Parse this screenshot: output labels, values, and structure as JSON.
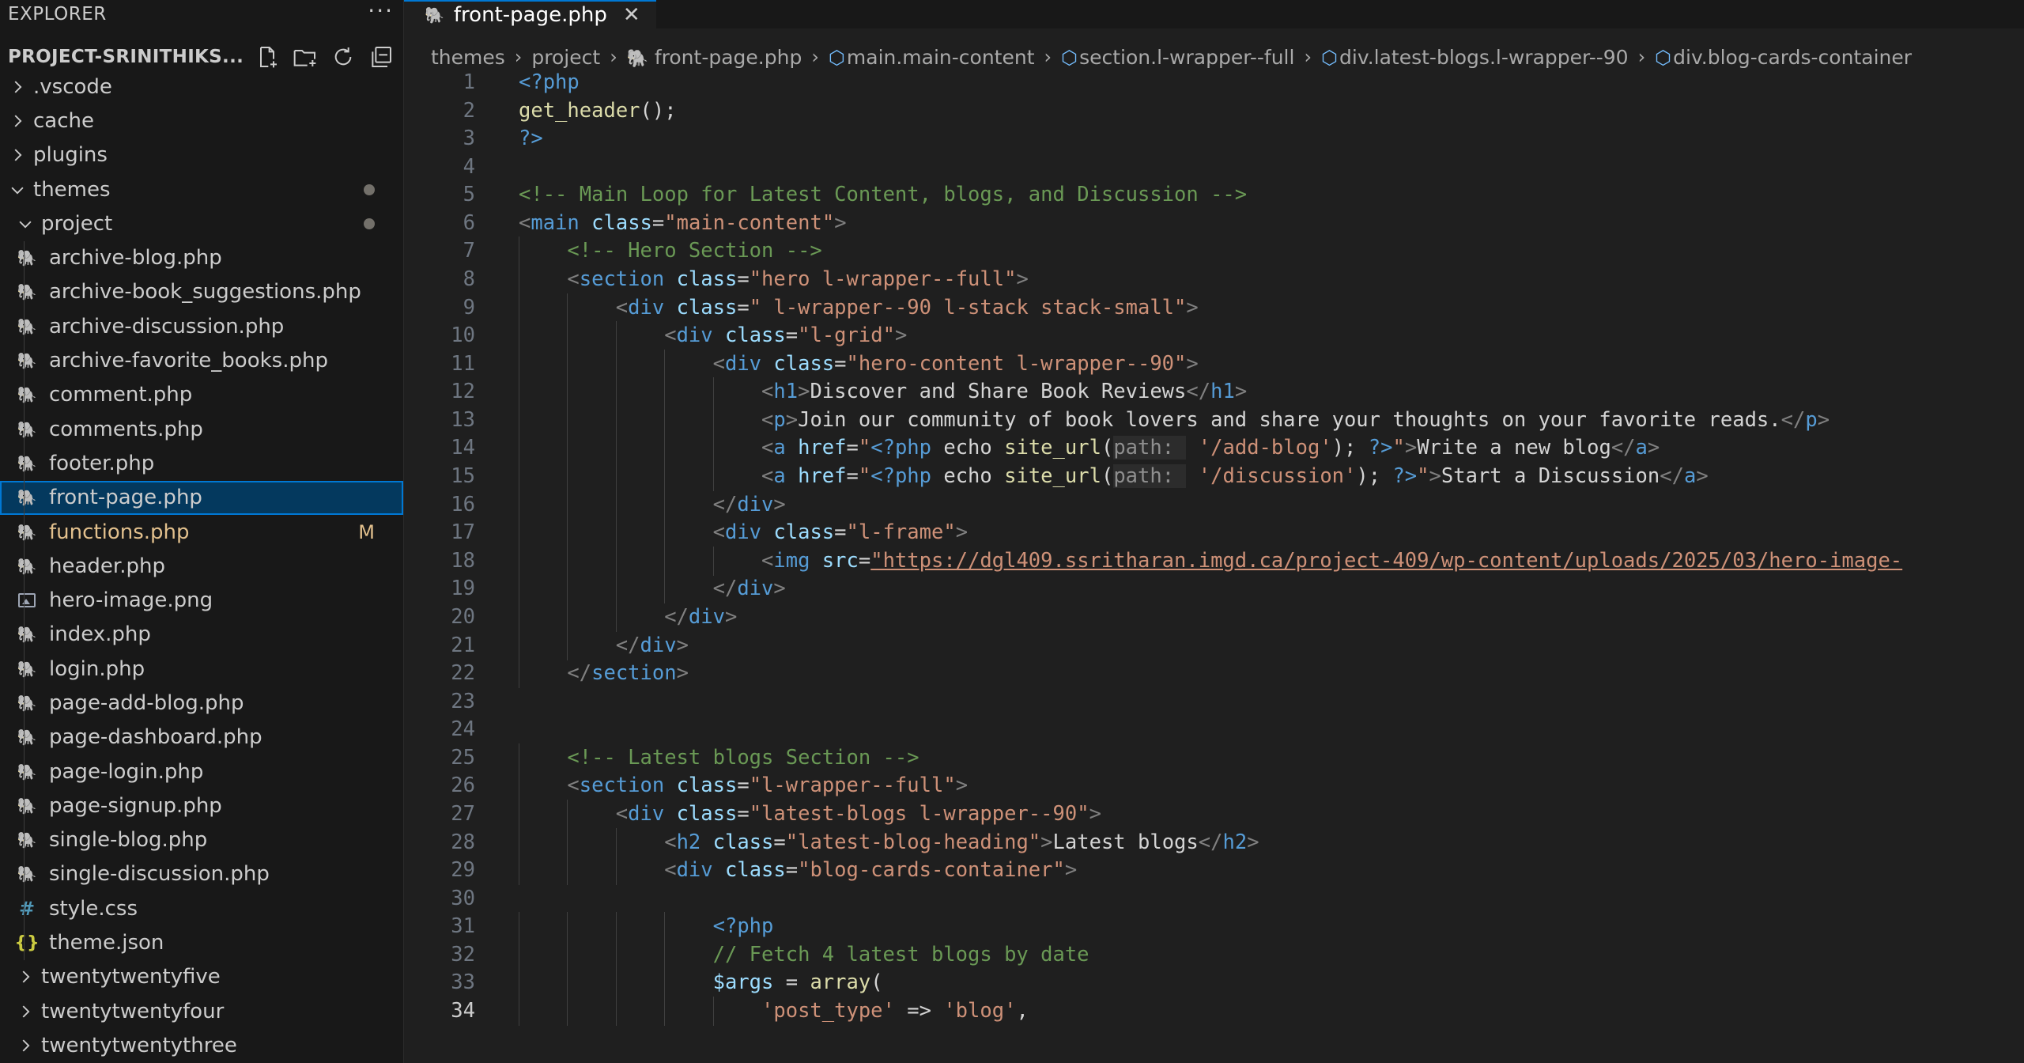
{
  "explorer": {
    "title": "EXPLORER",
    "more": "···",
    "project_name": "PROJECT-SRINITHIKS...",
    "tree": [
      {
        "label": ".vscode",
        "kind": "folder",
        "open": false,
        "depth": 0
      },
      {
        "label": "cache",
        "kind": "folder",
        "open": false,
        "depth": 0
      },
      {
        "label": "plugins",
        "kind": "folder",
        "open": false,
        "depth": 0
      },
      {
        "label": "themes",
        "kind": "folder",
        "open": true,
        "depth": 0,
        "dot": true
      },
      {
        "label": "project",
        "kind": "folder",
        "open": true,
        "depth": 1,
        "dot": true
      },
      {
        "label": "archive-blog.php",
        "kind": "php",
        "depth": 2
      },
      {
        "label": "archive-book_suggestions.php",
        "kind": "php",
        "depth": 2
      },
      {
        "label": "archive-discussion.php",
        "kind": "php",
        "depth": 2
      },
      {
        "label": "archive-favorite_books.php",
        "kind": "php",
        "depth": 2
      },
      {
        "label": "comment.php",
        "kind": "php",
        "depth": 2
      },
      {
        "label": "comments.php",
        "kind": "php",
        "depth": 2
      },
      {
        "label": "footer.php",
        "kind": "php",
        "depth": 2
      },
      {
        "label": "front-page.php",
        "kind": "php",
        "depth": 2,
        "selected": true
      },
      {
        "label": "functions.php",
        "kind": "php",
        "depth": 2,
        "badge": "M"
      },
      {
        "label": "header.php",
        "kind": "php",
        "depth": 2
      },
      {
        "label": "hero-image.png",
        "kind": "image",
        "depth": 2
      },
      {
        "label": "index.php",
        "kind": "php",
        "depth": 2
      },
      {
        "label": "login.php",
        "kind": "php",
        "depth": 2
      },
      {
        "label": "page-add-blog.php",
        "kind": "php",
        "depth": 2
      },
      {
        "label": "page-dashboard.php",
        "kind": "php",
        "depth": 2
      },
      {
        "label": "page-login.php",
        "kind": "php",
        "depth": 2
      },
      {
        "label": "page-signup.php",
        "kind": "php",
        "depth": 2
      },
      {
        "label": "single-blog.php",
        "kind": "php",
        "depth": 2
      },
      {
        "label": "single-discussion.php",
        "kind": "php",
        "depth": 2
      },
      {
        "label": "style.css",
        "kind": "css",
        "depth": 2
      },
      {
        "label": "theme.json",
        "kind": "json",
        "depth": 2
      },
      {
        "label": "twentytwentyfive",
        "kind": "folder",
        "open": false,
        "depth": 1
      },
      {
        "label": "twentytwentyfour",
        "kind": "folder",
        "open": false,
        "depth": 1
      },
      {
        "label": "twentytwentythree",
        "kind": "folder",
        "open": false,
        "depth": 1
      }
    ]
  },
  "editor": {
    "tab_label": "front-page.php",
    "tab_close": "✕",
    "breadcrumb": [
      {
        "label": "themes",
        "icon": ""
      },
      {
        "label": "project",
        "icon": ""
      },
      {
        "label": "front-page.php",
        "icon": "php"
      },
      {
        "label": "main.main-content",
        "icon": "cube"
      },
      {
        "label": "section.l-wrapper--full",
        "icon": "cube"
      },
      {
        "label": "div.latest-blogs.l-wrapper--90",
        "icon": "cube"
      },
      {
        "label": "div.blog-cards-container",
        "icon": "cube"
      }
    ],
    "active_line": 34,
    "lines": [
      {
        "n": "1",
        "indent": 0,
        "tokens": [
          [
            "php",
            "<?php"
          ]
        ]
      },
      {
        "n": "2",
        "indent": 0,
        "tokens": [
          [
            "fn",
            "get_header"
          ],
          [
            "txt",
            "();"
          ]
        ]
      },
      {
        "n": "3",
        "indent": 0,
        "tokens": [
          [
            "php",
            "?>"
          ]
        ]
      },
      {
        "n": "4",
        "indent": 0,
        "tokens": []
      },
      {
        "n": "5",
        "indent": 0,
        "tokens": [
          [
            "com",
            "<!-- Main Loop for Latest Content, blogs, and Discussion -->"
          ]
        ]
      },
      {
        "n": "6",
        "indent": 0,
        "tokens": [
          [
            "br",
            "<"
          ],
          [
            "tag",
            "main"
          ],
          [
            "txt",
            " "
          ],
          [
            "attr",
            "class"
          ],
          [
            "txt",
            "="
          ],
          [
            "str",
            "\"main-content\""
          ],
          [
            "br",
            ">"
          ]
        ]
      },
      {
        "n": "7",
        "indent": 1,
        "tokens": [
          [
            "com",
            "<!-- Hero Section -->"
          ]
        ]
      },
      {
        "n": "8",
        "indent": 1,
        "tokens": [
          [
            "br",
            "<"
          ],
          [
            "tag",
            "section"
          ],
          [
            "txt",
            " "
          ],
          [
            "attr",
            "class"
          ],
          [
            "txt",
            "="
          ],
          [
            "str",
            "\"hero l-wrapper--full\""
          ],
          [
            "br",
            ">"
          ]
        ]
      },
      {
        "n": "9",
        "indent": 2,
        "tokens": [
          [
            "br",
            "<"
          ],
          [
            "tag",
            "div"
          ],
          [
            "txt",
            " "
          ],
          [
            "attr",
            "class"
          ],
          [
            "txt",
            "="
          ],
          [
            "str",
            "\" l-wrapper--90 l-stack stack-small\""
          ],
          [
            "br",
            ">"
          ]
        ]
      },
      {
        "n": "10",
        "indent": 3,
        "tokens": [
          [
            "br",
            "<"
          ],
          [
            "tag",
            "div"
          ],
          [
            "txt",
            " "
          ],
          [
            "attr",
            "class"
          ],
          [
            "txt",
            "="
          ],
          [
            "str",
            "\"l-grid\""
          ],
          [
            "br",
            ">"
          ]
        ]
      },
      {
        "n": "11",
        "indent": 4,
        "tokens": [
          [
            "br",
            "<"
          ],
          [
            "tag",
            "div"
          ],
          [
            "txt",
            " "
          ],
          [
            "attr",
            "class"
          ],
          [
            "txt",
            "="
          ],
          [
            "str",
            "\"hero-content l-wrapper--90\""
          ],
          [
            "br",
            ">"
          ]
        ]
      },
      {
        "n": "12",
        "indent": 5,
        "tokens": [
          [
            "br",
            "<"
          ],
          [
            "tag",
            "h1"
          ],
          [
            "br",
            ">"
          ],
          [
            "txt",
            "Discover and Share Book Reviews"
          ],
          [
            "br",
            "</"
          ],
          [
            "tag",
            "h1"
          ],
          [
            "br",
            ">"
          ]
        ]
      },
      {
        "n": "13",
        "indent": 5,
        "tokens": [
          [
            "br",
            "<"
          ],
          [
            "tag",
            "p"
          ],
          [
            "br",
            ">"
          ],
          [
            "txt",
            "Join our community of book lovers and share your thoughts on your favorite reads."
          ],
          [
            "br",
            "</"
          ],
          [
            "tag",
            "p"
          ],
          [
            "br",
            ">"
          ]
        ]
      },
      {
        "n": "14",
        "indent": 5,
        "tokens": [
          [
            "br",
            "<"
          ],
          [
            "tag",
            "a"
          ],
          [
            "txt",
            " "
          ],
          [
            "attr",
            "href"
          ],
          [
            "txt",
            "="
          ],
          [
            "str",
            "\""
          ],
          [
            "php",
            "<?php"
          ],
          [
            "txt",
            " echo "
          ],
          [
            "fn",
            "site_url"
          ],
          [
            "txt",
            "("
          ],
          [
            "hint",
            "path: "
          ],
          [
            "txt",
            " "
          ],
          [
            "str",
            "'/add-blog'"
          ],
          [
            "txt",
            "); "
          ],
          [
            "php",
            "?>"
          ],
          [
            "str",
            "\""
          ],
          [
            "br",
            ">"
          ],
          [
            "txt",
            "Write a new blog"
          ],
          [
            "br",
            "</"
          ],
          [
            "tag",
            "a"
          ],
          [
            "br",
            ">"
          ]
        ]
      },
      {
        "n": "15",
        "indent": 5,
        "tokens": [
          [
            "br",
            "<"
          ],
          [
            "tag",
            "a"
          ],
          [
            "txt",
            " "
          ],
          [
            "attr",
            "href"
          ],
          [
            "txt",
            "="
          ],
          [
            "str",
            "\""
          ],
          [
            "php",
            "<?php"
          ],
          [
            "txt",
            " echo "
          ],
          [
            "fn",
            "site_url"
          ],
          [
            "txt",
            "("
          ],
          [
            "hint",
            "path: "
          ],
          [
            "txt",
            " "
          ],
          [
            "str",
            "'/discussion'"
          ],
          [
            "txt",
            "); "
          ],
          [
            "php",
            "?>"
          ],
          [
            "str",
            "\""
          ],
          [
            "br",
            ">"
          ],
          [
            "txt",
            "Start a Discussion"
          ],
          [
            "br",
            "</"
          ],
          [
            "tag",
            "a"
          ],
          [
            "br",
            ">"
          ]
        ]
      },
      {
        "n": "16",
        "indent": 4,
        "tokens": [
          [
            "br",
            "</"
          ],
          [
            "tag",
            "div"
          ],
          [
            "br",
            ">"
          ]
        ]
      },
      {
        "n": "17",
        "indent": 4,
        "tokens": [
          [
            "br",
            "<"
          ],
          [
            "tag",
            "div"
          ],
          [
            "txt",
            " "
          ],
          [
            "attr",
            "class"
          ],
          [
            "txt",
            "="
          ],
          [
            "str",
            "\"l-frame\""
          ],
          [
            "br",
            ">"
          ]
        ]
      },
      {
        "n": "18",
        "indent": 5,
        "tokens": [
          [
            "br",
            "<"
          ],
          [
            "tag",
            "img"
          ],
          [
            "txt",
            " "
          ],
          [
            "attr",
            "src"
          ],
          [
            "txt",
            "="
          ],
          [
            "url",
            "\"https://dgl409.ssritharan.imgd.ca/project-409/wp-content/uploads/2025/03/hero-image-"
          ]
        ]
      },
      {
        "n": "19",
        "indent": 4,
        "tokens": [
          [
            "br",
            "</"
          ],
          [
            "tag",
            "div"
          ],
          [
            "br",
            ">"
          ]
        ]
      },
      {
        "n": "20",
        "indent": 3,
        "tokens": [
          [
            "br",
            "</"
          ],
          [
            "tag",
            "div"
          ],
          [
            "br",
            ">"
          ]
        ]
      },
      {
        "n": "21",
        "indent": 2,
        "tokens": [
          [
            "br",
            "</"
          ],
          [
            "tag",
            "div"
          ],
          [
            "br",
            ">"
          ]
        ]
      },
      {
        "n": "22",
        "indent": 1,
        "tokens": [
          [
            "br",
            "</"
          ],
          [
            "tag",
            "section"
          ],
          [
            "br",
            ">"
          ]
        ]
      },
      {
        "n": "23",
        "indent": 0,
        "tokens": []
      },
      {
        "n": "24",
        "indent": 0,
        "tokens": []
      },
      {
        "n": "25",
        "indent": 1,
        "tokens": [
          [
            "com",
            "<!-- Latest blogs Section -->"
          ]
        ]
      },
      {
        "n": "26",
        "indent": 1,
        "tokens": [
          [
            "br",
            "<"
          ],
          [
            "tag",
            "section"
          ],
          [
            "txt",
            " "
          ],
          [
            "attr",
            "class"
          ],
          [
            "txt",
            "="
          ],
          [
            "str",
            "\"l-wrapper--full\""
          ],
          [
            "br",
            ">"
          ]
        ]
      },
      {
        "n": "27",
        "indent": 2,
        "tokens": [
          [
            "br",
            "<"
          ],
          [
            "tag",
            "div"
          ],
          [
            "txt",
            " "
          ],
          [
            "attr",
            "class"
          ],
          [
            "txt",
            "="
          ],
          [
            "str",
            "\"latest-blogs l-wrapper--90\""
          ],
          [
            "br",
            ">"
          ]
        ]
      },
      {
        "n": "28",
        "indent": 3,
        "tokens": [
          [
            "br",
            "<"
          ],
          [
            "tag",
            "h2"
          ],
          [
            "txt",
            " "
          ],
          [
            "attr",
            "class"
          ],
          [
            "txt",
            "="
          ],
          [
            "str",
            "\"latest-blog-heading\""
          ],
          [
            "br",
            ">"
          ],
          [
            "txt",
            "Latest blogs"
          ],
          [
            "br",
            "</"
          ],
          [
            "tag",
            "h2"
          ],
          [
            "br",
            ">"
          ]
        ]
      },
      {
        "n": "29",
        "indent": 3,
        "tokens": [
          [
            "br",
            "<"
          ],
          [
            "tag",
            "div"
          ],
          [
            "txt",
            " "
          ],
          [
            "attr",
            "class"
          ],
          [
            "txt",
            "="
          ],
          [
            "str",
            "\"blog-cards-container\""
          ],
          [
            "br",
            ">"
          ]
        ]
      },
      {
        "n": "30",
        "indent": 0,
        "tokens": []
      },
      {
        "n": "31",
        "indent": 4,
        "tokens": [
          [
            "php",
            "<?php"
          ]
        ]
      },
      {
        "n": "32",
        "indent": 4,
        "tokens": [
          [
            "com",
            "// Fetch 4 latest blogs by date"
          ]
        ]
      },
      {
        "n": "33",
        "indent": 4,
        "tokens": [
          [
            "var",
            "$args"
          ],
          [
            "txt",
            " = "
          ],
          [
            "fn",
            "array"
          ],
          [
            "txt",
            "("
          ]
        ]
      },
      {
        "n": "34",
        "indent": 5,
        "tokens": [
          [
            "str",
            "'post_type'"
          ],
          [
            "txt",
            " => "
          ],
          [
            "str",
            "'blog'"
          ],
          [
            "txt",
            ","
          ]
        ]
      }
    ]
  },
  "colors": {
    "accent": "#0078d4",
    "selected_bg": "#04395e",
    "modified_badge": "#e2c08d"
  }
}
